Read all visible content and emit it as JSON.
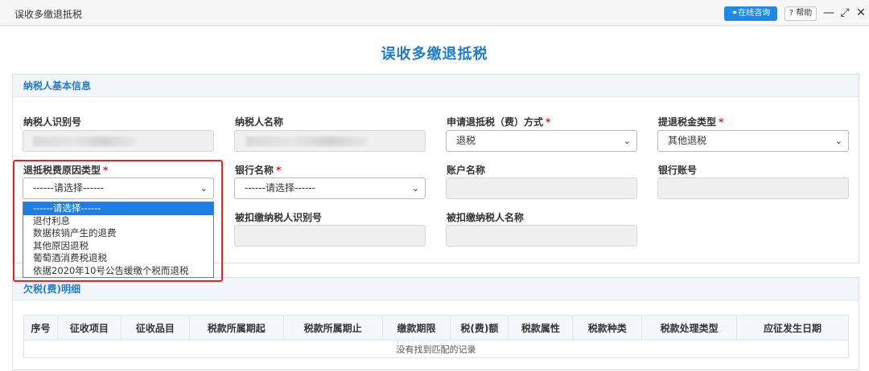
{
  "window": {
    "title": "误收多缴退抵税",
    "consult_label": "在线咨询",
    "help_label": "? 帮助",
    "minimize_glyph": "—",
    "maximize_glyph": "⤢",
    "close_glyph": "✕"
  },
  "page": {
    "title": "误收多缴退抵税"
  },
  "basic_info": {
    "section_title": "纳税人基本信息",
    "taxpayer_id_label": "纳税人识别号",
    "taxpayer_name_label": "纳税人名称",
    "refund_method_label": "申请退抵税（费）方式",
    "refund_method_value": "退税",
    "refund_type_label": "提退税金类型",
    "refund_type_value": "其他退税",
    "reason_label": "退抵税费原因类型",
    "reason_value": "------请选择------",
    "bank_name_label": "银行名称",
    "bank_name_value": "------请选择------",
    "account_name_label": "账户名称",
    "bank_account_label": "银行账号",
    "withheld_id_label": "被扣缴纳税人识别号",
    "withheld_name_label": "被扣缴纳税人名称",
    "required_mark": "*"
  },
  "reason_options": [
    "------请选择------",
    "退付利息",
    "数据核销产生的退费",
    "其他原因退税",
    "葡萄酒消费税退税",
    "依据2020年10号公告缓缴个税而退税"
  ],
  "arrears": {
    "section_title": "欠税(费)明细",
    "columns": [
      "序号",
      "征收项目",
      "征收品目",
      "税款所属期起",
      "税款所属期止",
      "缴款期限",
      "税(费)额",
      "税款属性",
      "税款种类",
      "税款处理类型",
      "应征发生日期"
    ],
    "empty_text": "没有找到匹配的记录"
  },
  "colors": {
    "accent": "#1f7bd4",
    "required": "#e02020",
    "highlight_box": "#ee2222",
    "selected_option": "#1e7ee6"
  }
}
